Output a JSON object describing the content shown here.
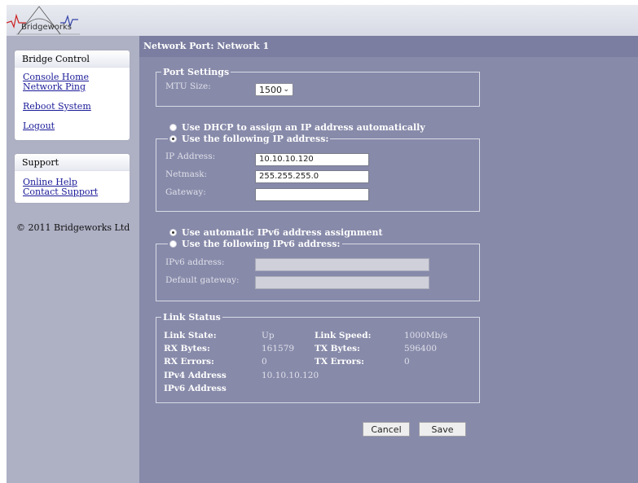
{
  "header": {
    "logo_text": "Bridgeworks"
  },
  "sidebar": {
    "bridge_control": {
      "title": "Bridge Control",
      "links": [
        "Console Home",
        "Network Ping",
        "Reboot System",
        "Logout"
      ]
    },
    "support": {
      "title": "Support",
      "links": [
        "Online Help",
        "Contact Support"
      ]
    },
    "copyright": "© 2011 Bridgeworks Ltd"
  },
  "main": {
    "title": "Network Port: Network 1",
    "port_settings": {
      "legend": "Port Settings",
      "mtu_label": "MTU Size:",
      "mtu_value": "1500"
    },
    "ipv4": {
      "dhcp_option": "Use DHCP to assign an IP address automatically",
      "static_option": "Use the following IP address:",
      "selected": "static",
      "ip_label": "IP Address:",
      "ip_value": "10.10.10.120",
      "netmask_label": "Netmask:",
      "netmask_value": "255.255.255.0",
      "gateway_label": "Gateway:",
      "gateway_value": ""
    },
    "ipv6": {
      "auto_option": "Use automatic IPv6 address assignment",
      "static_option": "Use the following IPv6 address:",
      "selected": "auto",
      "address_label": "IPv6 address:",
      "address_value": "",
      "gateway_label": "Default gateway:",
      "gateway_value": ""
    },
    "link_status": {
      "legend": "Link Status",
      "link_state_label": "Link State:",
      "link_state_value": "Up",
      "link_speed_label": "Link Speed:",
      "link_speed_value": "1000Mb/s",
      "rx_bytes_label": "RX Bytes:",
      "rx_bytes_value": "161579",
      "tx_bytes_label": "TX Bytes:",
      "tx_bytes_value": "596400",
      "rx_errors_label": "RX Errors:",
      "rx_errors_value": "0",
      "tx_errors_label": "TX Errors:",
      "tx_errors_value": "0",
      "ipv4_label": "IPv4 Address",
      "ipv4_value": "10.10.10.120",
      "ipv6_label": "IPv6 Address",
      "ipv6_value": ""
    },
    "buttons": {
      "cancel": "Cancel",
      "save": "Save"
    }
  },
  "colors": {
    "sidebar_bg": "#aeb0c4",
    "main_bg": "#878aa9",
    "title_bar": "#7b7ea0",
    "link": "#1a1a99"
  }
}
